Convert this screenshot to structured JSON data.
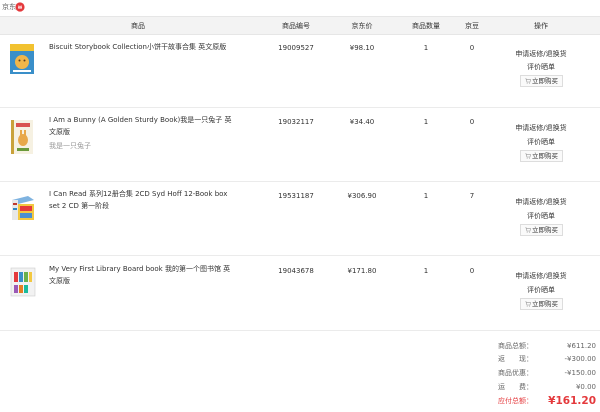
{
  "shop": {
    "name": "京东",
    "icon": "jd-dog-icon",
    "brand_color": "#e4393c"
  },
  "columns": {
    "product": "商品",
    "sku": "商品编号",
    "price": "京东价",
    "qty": "商品数量",
    "beans": "京豆",
    "ops": "操作"
  },
  "products": [
    {
      "name": "Biscuit Storybook Collection小饼干故事合集 英文原版",
      "subtitle": "",
      "sku": "19009527",
      "price": "¥98.10",
      "qty": "1",
      "beans": "0",
      "ops": [
        "申请返修/退换货",
        "评价晒单"
      ],
      "buy_label": "立即购买",
      "thumb_icon": "biscuit-book-cover-icon"
    },
    {
      "name": "I Am a Bunny (A Golden Sturdy Book)我是一只兔子 英文原版",
      "subtitle": "我是一只兔子",
      "sku": "19032117",
      "price": "¥34.40",
      "qty": "1",
      "beans": "0",
      "ops": [
        "申请返修/退换货",
        "评价晒单"
      ],
      "buy_label": "立即购买",
      "thumb_icon": "bunny-book-cover-icon"
    },
    {
      "name": "I Can Read 系列12册合集 2CD Syd Hoff 12-Book box set 2 CD 第一阶段",
      "subtitle": "",
      "sku": "19531187",
      "price": "¥306.90",
      "qty": "1",
      "beans": "7",
      "ops": [
        "申请返修/退换货",
        "评价晒单"
      ],
      "buy_label": "立即购买",
      "thumb_icon": "box-set-cover-icon"
    },
    {
      "name": "My Very First Library Board book 我的第一个图书馆 英文原版",
      "subtitle": "",
      "sku": "19043678",
      "price": "¥171.80",
      "qty": "1",
      "beans": "0",
      "ops": [
        "申请返修/退换货",
        "评价晒单"
      ],
      "buy_label": "立即购买",
      "thumb_icon": "library-board-book-icon"
    }
  ],
  "summary": {
    "items": [
      {
        "label": "商品总额：",
        "value": "¥611.20"
      },
      {
        "label": "返　　现：",
        "value": "-¥300.00"
      },
      {
        "label": "商品优惠：",
        "value": "-¥150.00"
      },
      {
        "label": "运　　费：",
        "value": "¥0.00"
      }
    ],
    "total_label": "应付总额：",
    "total_value": "¥161.20"
  },
  "colors": {
    "accent": "#e4393c",
    "header_bg": "#f3f3f3",
    "border": "#ebebeb"
  }
}
